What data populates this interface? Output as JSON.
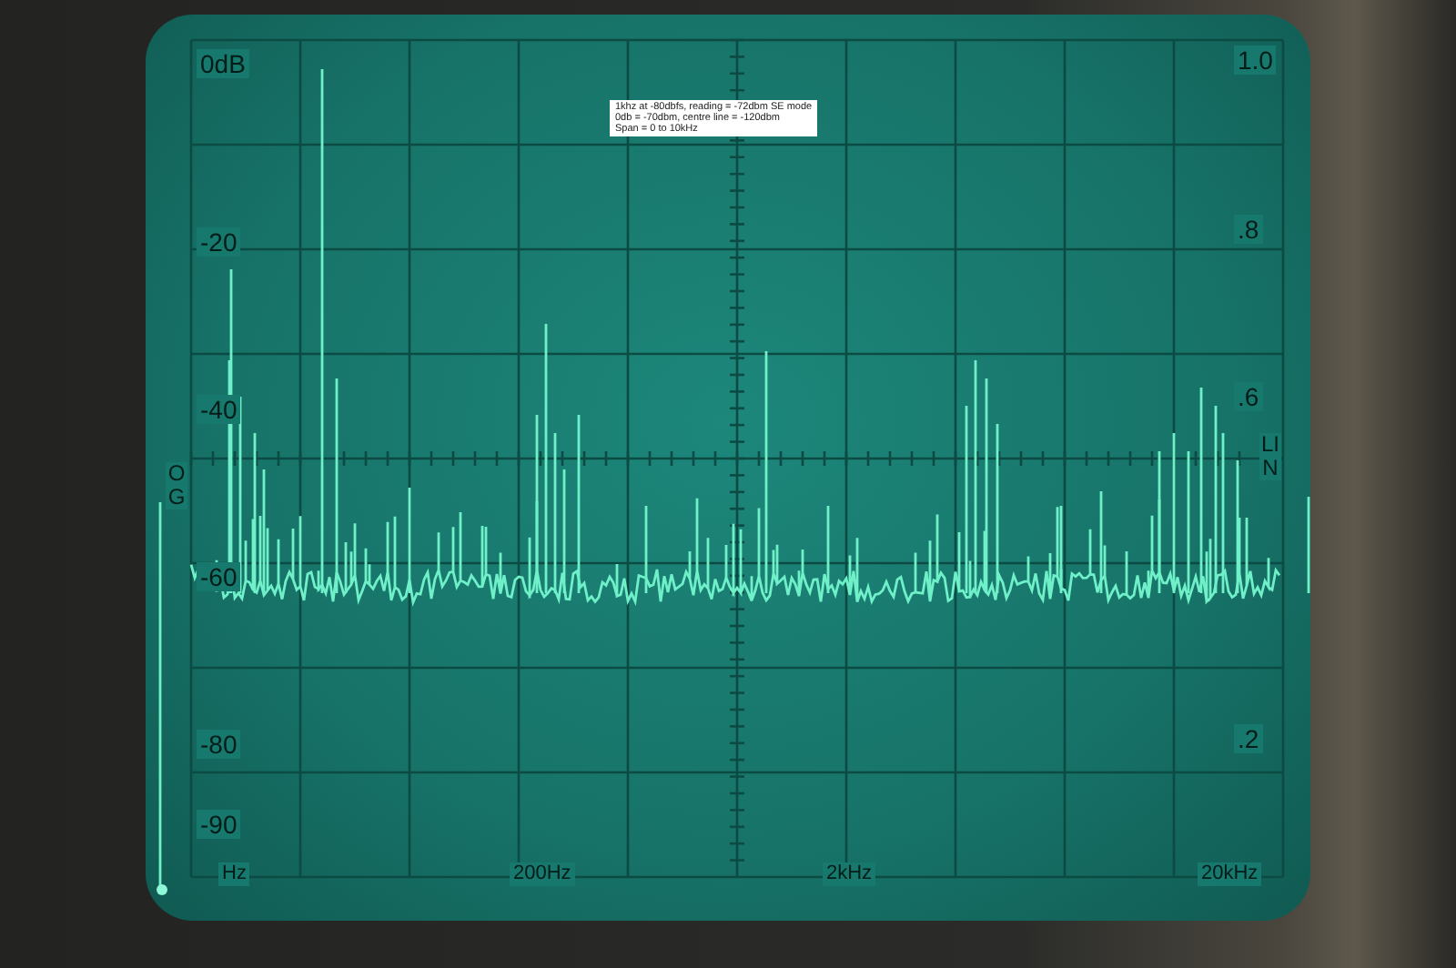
{
  "annotation": {
    "lines": [
      "1khz at -80dbfs, reading = -72dbm SE mode",
      "0db = -70dbm, centre line = -120dbm",
      "Span = 0 to 10kHz"
    ]
  },
  "left_scale": {
    "labels": [
      "0dB",
      "-20",
      "-40",
      "-60",
      "-80",
      "-90"
    ],
    "mode": "OG"
  },
  "right_scale": {
    "labels": [
      "1.0",
      ".8",
      ".6",
      ".2"
    ],
    "mode": "LIN"
  },
  "frequency_labels": [
    "Hz",
    "200Hz",
    "2kHz",
    "20kHz"
  ]
}
